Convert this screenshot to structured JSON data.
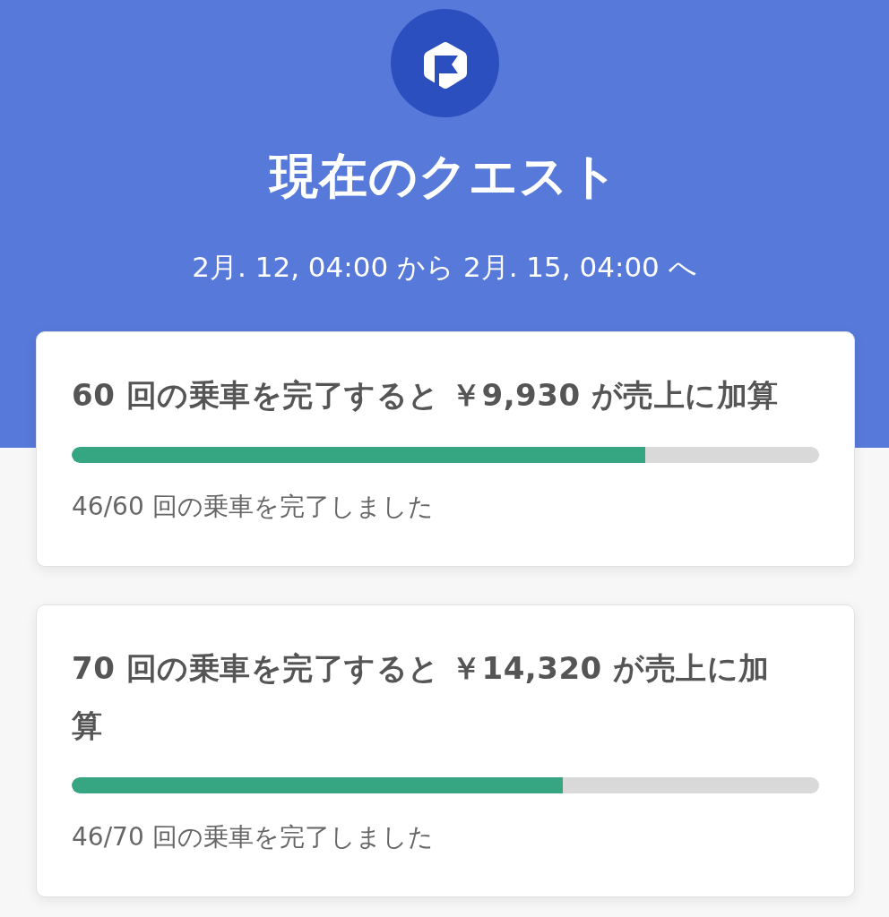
{
  "header": {
    "title": "現在のクエスト",
    "date_range": "2月. 12, 04:00 から 2月. 15, 04:00 へ"
  },
  "quests": [
    {
      "title": "60 回の乗車を完了すると ￥9,930 が売上に加算",
      "level": 0.767,
      "progress": "46/60 回の乗車を完了しました"
    },
    {
      "title": "70 回の乗車を完了すると ￥14,320 が売上に加算",
      "level": 0.657,
      "progress": "46/70 回の乗車を完了しました"
    }
  ]
}
